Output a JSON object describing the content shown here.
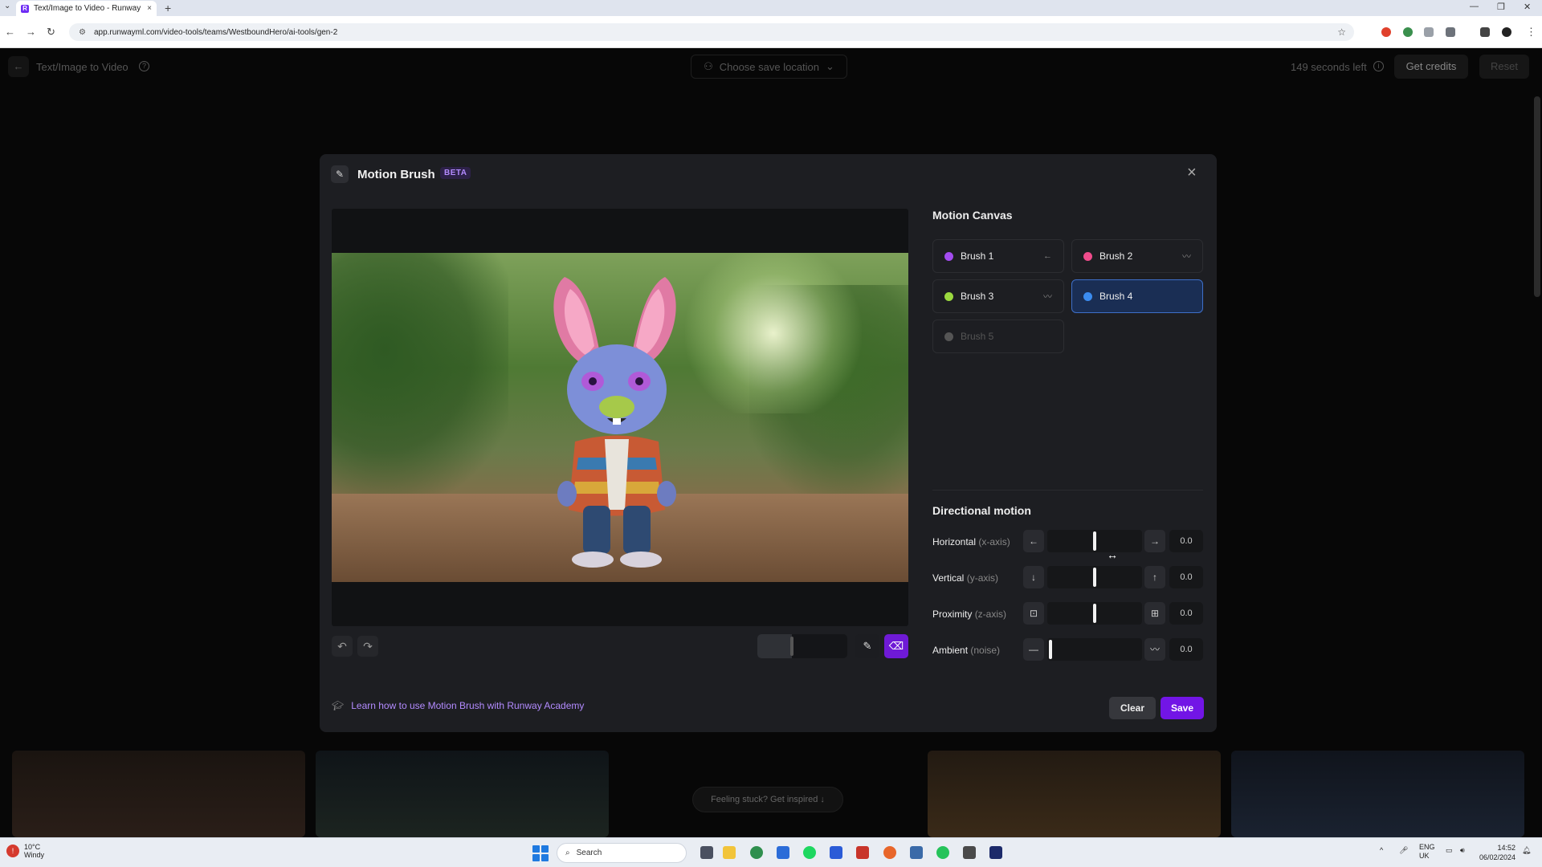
{
  "browser": {
    "tab_title": "Text/Image to Video - Runway",
    "tab_close": "×",
    "new_tab": "+",
    "url": "app.runwayml.com/video-tools/teams/WestboundHero/ai-tools/gen-2",
    "favicon_letter": "R"
  },
  "app_header": {
    "title": "Text/Image to Video",
    "save_location": "Choose save location",
    "seconds_left": "149 seconds left",
    "get_credits": "Get credits",
    "reset": "Reset"
  },
  "modal": {
    "title": "Motion Brush",
    "badge": "BETA",
    "close": "×",
    "academy_link": "Learn how to use Motion Brush with Runway Academy",
    "clear": "Clear",
    "save": "Save",
    "brush_size_level": 0.38
  },
  "motion_canvas": {
    "title": "Motion Canvas",
    "brushes": [
      {
        "label": "Brush 1",
        "color": "#a34cf0",
        "icon": "arrow-left-icon",
        "icon_glyph": "←",
        "active": false,
        "disabled": false
      },
      {
        "label": "Brush 2",
        "color": "#f04c8c",
        "icon": "ambient-wave-icon",
        "icon_glyph": "〰",
        "active": false,
        "disabled": false
      },
      {
        "label": "Brush 3",
        "color": "#9bd93f",
        "icon": "ambient-wave-icon",
        "icon_glyph": "〰",
        "active": false,
        "disabled": false
      },
      {
        "label": "Brush 4",
        "color": "#3b8cf0",
        "icon": "",
        "icon_glyph": "",
        "active": true,
        "disabled": false
      },
      {
        "label": "Brush 5",
        "color": "#555555",
        "icon": "",
        "icon_glyph": "",
        "active": false,
        "disabled": true
      }
    ]
  },
  "directional_motion": {
    "title": "Directional motion",
    "rows": [
      {
        "label": "Horizontal",
        "axis": "(x-axis)",
        "left_icon": "←",
        "right_icon": "→",
        "value": "0.0",
        "level": 0.5
      },
      {
        "label": "Vertical",
        "axis": "(y-axis)",
        "left_icon": "↓",
        "right_icon": "↑",
        "value": "0.0",
        "level": 0.5
      },
      {
        "label": "Proximity",
        "axis": "(z-axis)",
        "left_icon": "⊡",
        "right_icon": "⊞",
        "value": "0.0",
        "level": 0.5
      },
      {
        "label": "Ambient",
        "axis": "(noise)",
        "left_icon": "—",
        "right_icon": "〰",
        "value": "0.0",
        "level": 0.0
      }
    ]
  },
  "page_bottom": {
    "inspire": "Feeling stuck? Get inspired ↓"
  },
  "taskbar": {
    "temp": "10°C",
    "condition": "Windy",
    "search": "Search",
    "lang_1": "ENG",
    "lang_2": "UK",
    "time": "14:52",
    "date": "06/02/2024"
  }
}
